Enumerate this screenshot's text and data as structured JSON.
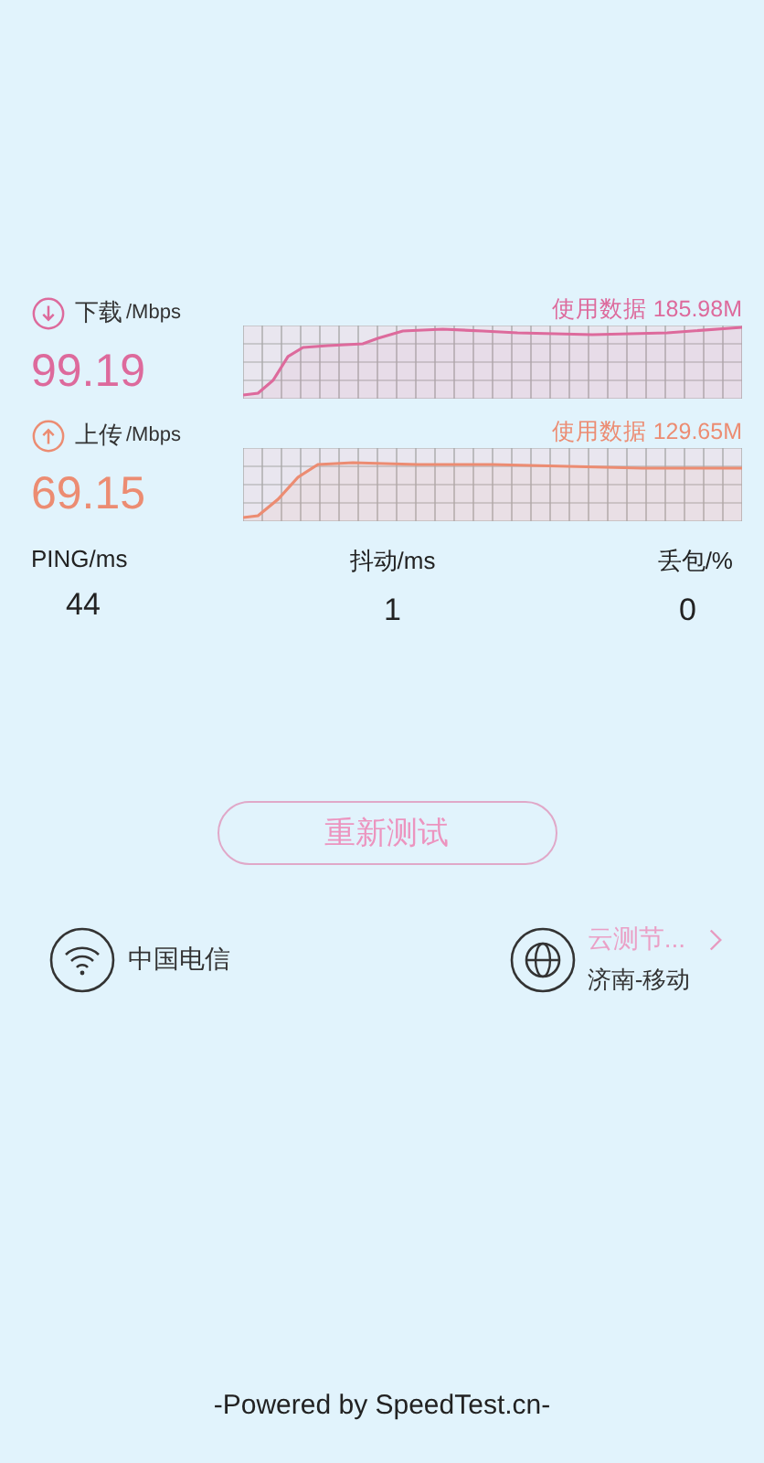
{
  "results": [
    {
      "kind": "download",
      "label": "下载",
      "unit": "/Mbps",
      "value": "99.19",
      "usage": "使用数据 185.98M",
      "color": "#dd6a9c"
    },
    {
      "kind": "upload",
      "label": "上传",
      "unit": "/Mbps",
      "value": "69.15",
      "usage": "使用数据 129.65M",
      "color": "#ec8c72"
    }
  ],
  "stats": [
    {
      "label": "PING/ms",
      "value": "44"
    },
    {
      "label": "抖动/ms",
      "value": "1"
    },
    {
      "label": "丢包/%",
      "value": "0"
    }
  ],
  "retest_button": "重新测试",
  "network": {
    "operator": "中国电信"
  },
  "server": {
    "name": "云测节...",
    "location": "济南-移动"
  },
  "footer": "-Powered by SpeedTest.cn-"
}
